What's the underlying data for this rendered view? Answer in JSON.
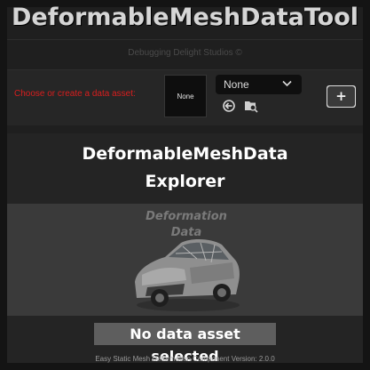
{
  "header": {
    "title": "DeformableMeshDataTool",
    "subtitle": "Debugging Delight Studios ©"
  },
  "asset_picker": {
    "label": "Choose or create a data asset:",
    "thumbnail_label": "None",
    "selected_value": "None",
    "icons": [
      "browse-back-icon",
      "find-in-folder-icon",
      "chevron-down-icon"
    ],
    "add_button_label": "+"
  },
  "explorer": {
    "title_line1": "DeformableMeshData",
    "title_line2": "Explorer",
    "image_caption_line1": "Deformation",
    "image_caption_line2": "Data",
    "status": "No data asset selected"
  },
  "footer": {
    "version": "Easy Static Mesh Deformation Component Version: 2.0.0"
  },
  "colors": {
    "label_red": "#d81e1e",
    "background": "#141414",
    "panel": "#1f1f1f"
  }
}
